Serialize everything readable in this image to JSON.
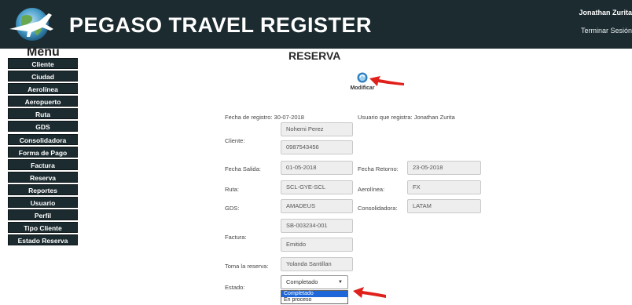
{
  "header": {
    "title": "PEGASO TRAVEL REGISTER",
    "user": "Jonathan Zurita",
    "logout": "Terminar Sesión"
  },
  "sidebar": {
    "title": "Menú",
    "items": [
      {
        "label": "Cliente"
      },
      {
        "label": "Ciudad"
      },
      {
        "label": "Aerolínea"
      },
      {
        "label": "Aeropuerto"
      },
      {
        "label": "Ruta"
      },
      {
        "label": "GDS"
      },
      {
        "label": "Consolidadora"
      },
      {
        "label": "Forma de Pago"
      },
      {
        "label": "Factura"
      },
      {
        "label": "Reserva"
      },
      {
        "label": "Reportes"
      },
      {
        "label": "Usuario"
      },
      {
        "label": "Perfil"
      },
      {
        "label": "Tipo Cliente"
      },
      {
        "label": "Estado Reserva"
      }
    ]
  },
  "main": {
    "title": "RESERVA",
    "modify_label": "Modificar",
    "registration_date_label": "Fecha de registro: 30-07-2018",
    "registered_by_label": "Usuario que registra: Jonathan Zurita",
    "client_label": "Cliente:",
    "client_name": "Nohemi Perez",
    "client_id": "0987543456",
    "departure_label": "Fecha Salida:",
    "departure_value": "01-05-2018",
    "return_label": "Fecha Retorno:",
    "return_value": "23-05-2018",
    "route_label": "Ruta:",
    "route_value": "SCL-GYE-SCL",
    "airline_label": "Aerolínea:",
    "airline_value": "FX",
    "gds_label": "GDS:",
    "gds_value": "AMADEUS",
    "consolidator_label": "Consolidadora:",
    "consolidator_value": "LATAM",
    "invoice_label": "Factura:",
    "invoice_number": "SB-003234-001",
    "invoice_status": "Emitido",
    "taken_by_label": "Toma la reserva:",
    "taken_by_value": "Yolanda Santillan",
    "status_label": "Estado:",
    "status_selected": "Completado",
    "status_options": [
      "Completado",
      "En proceso"
    ]
  },
  "colors": {
    "header_bg": "#1c2b30",
    "menu_bg": "#1c2b30",
    "annotation_arrow": "#e0201b",
    "option_highlight": "#1e67d8"
  }
}
